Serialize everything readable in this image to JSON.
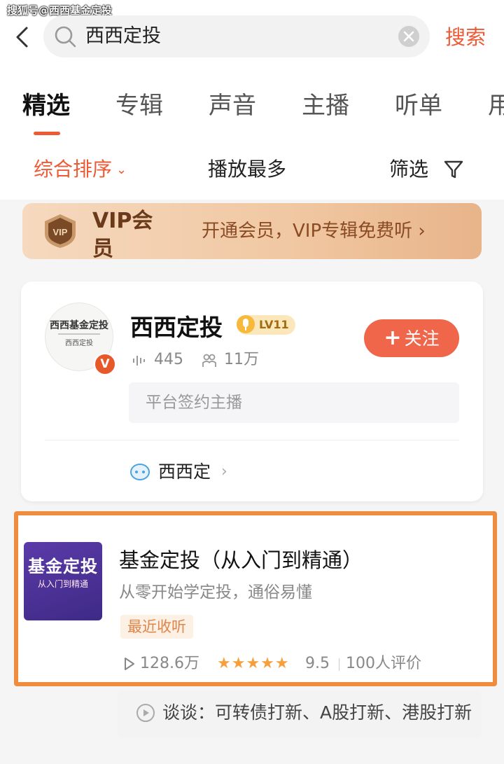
{
  "watermark": "搜狐号@西西基金定投",
  "search": {
    "query": "西西定投",
    "button_label": "搜索"
  },
  "tabs": [
    {
      "label": "精选",
      "active": true
    },
    {
      "label": "专辑"
    },
    {
      "label": "声音"
    },
    {
      "label": "主播"
    },
    {
      "label": "听单"
    },
    {
      "label": "用"
    }
  ],
  "sort": {
    "options": [
      "综合排序",
      "播放最多"
    ],
    "filter_label": "筛选"
  },
  "vip_banner": {
    "title": "VIP会员",
    "badge": "VIP",
    "description": "开通会员，VIP专辑免费听",
    "chevron": "›"
  },
  "anchor": {
    "avatar_text": "西西基金定投",
    "verified_mark": "V",
    "name": "西西定投",
    "level": "LV11",
    "tracks_count": "445",
    "followers": "11万",
    "follow_label": "关注",
    "follow_plus": "+",
    "tag": "平台签约主播",
    "bot_name": "西西定",
    "bot_chevron": "›"
  },
  "album": {
    "cover_title": "基金定投",
    "cover_subtitle": "从入门到精通",
    "title": "基金定投（从入门到精通）",
    "description": "从零开始学定投，通俗易懂",
    "tag": "最近收听",
    "plays": "128.6万",
    "stars": "★★★★★",
    "rating": "9.5",
    "reviews": "100人评价"
  },
  "track": {
    "title": "谈谈：可转债打新、A股打新、港股打新"
  },
  "colors": {
    "accent": "#ec5a36",
    "highlight_border": "#f08c3e",
    "star": "#f5a03c",
    "follow_button": "#f0664a"
  }
}
